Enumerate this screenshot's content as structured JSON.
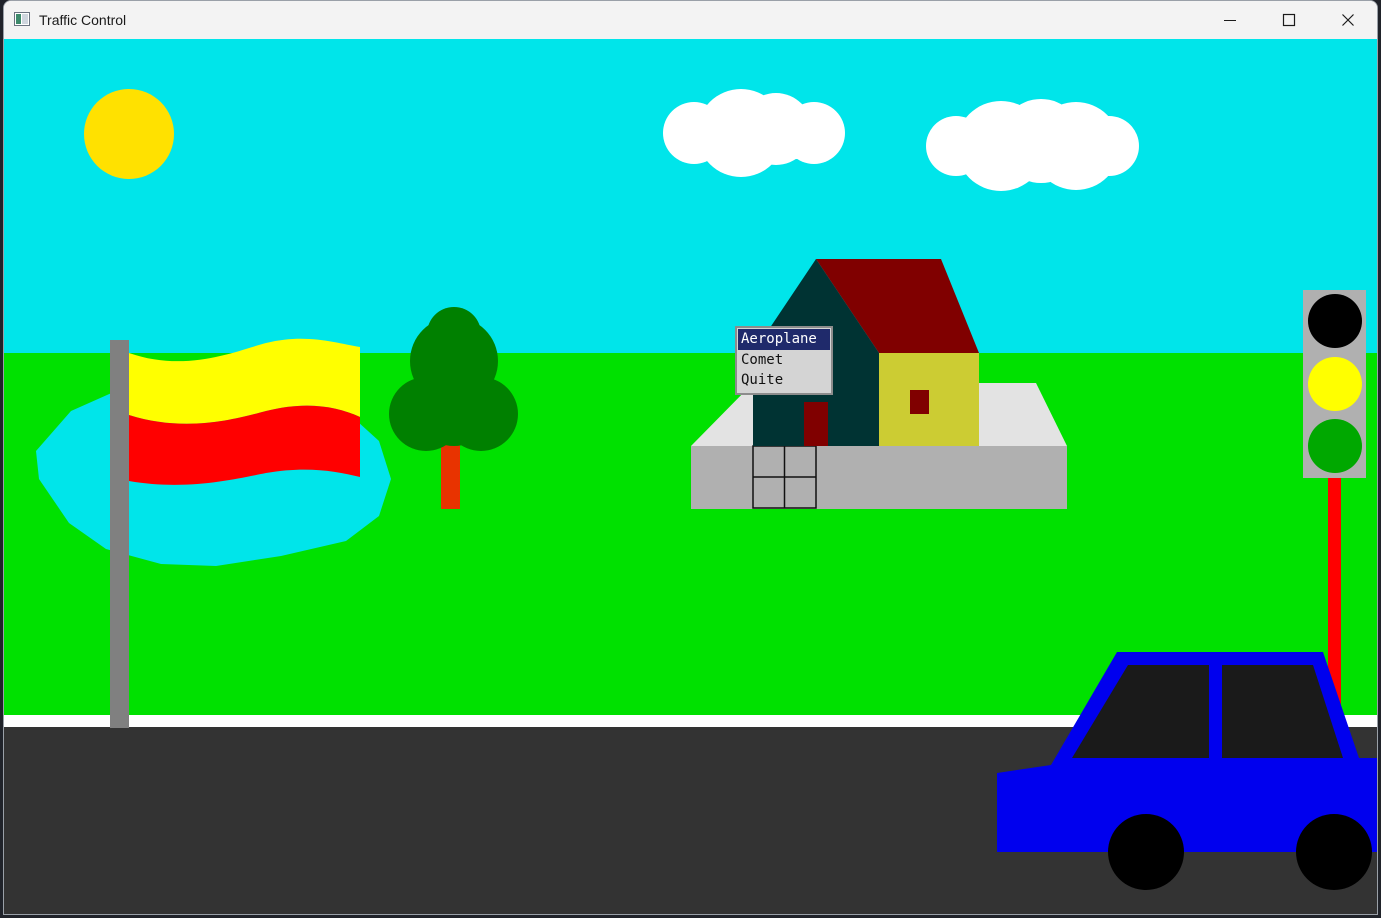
{
  "window": {
    "title": "Traffic Control",
    "app_icon": "app-window-icon",
    "controls": [
      "minimize-icon",
      "maximize-icon",
      "close-icon"
    ]
  },
  "popup_menu": {
    "items": [
      {
        "label": "Aeroplane",
        "selected": true
      },
      {
        "label": "Comet",
        "selected": false
      },
      {
        "label": "Quite",
        "selected": false
      }
    ]
  },
  "traffic_light": {
    "lamps": [
      "red-lamp-off",
      "yellow-lamp-on",
      "green-lamp-on"
    ]
  },
  "colors": {
    "sky": "#00e5ea",
    "grass": "#00e100",
    "road": "#333333",
    "sun": "#ffe100",
    "car_body": "#0000ee",
    "flag_top": "#ffff00",
    "flag_bottom": "#ff0000",
    "roof": "#800000",
    "house_wall": "#cccc33",
    "house_dark": "#003333",
    "selected_menu_item": "#1f2a6b"
  }
}
